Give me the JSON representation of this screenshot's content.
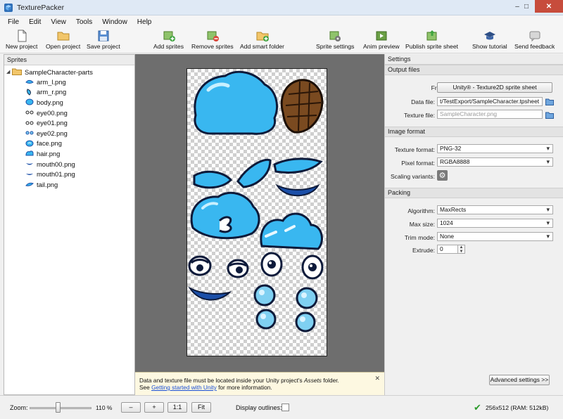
{
  "window": {
    "title": "TexturePacker",
    "controls": {
      "minimize": "–",
      "maximize": "□",
      "close": "✕"
    }
  },
  "menu": [
    "File",
    "Edit",
    "View",
    "Tools",
    "Window",
    "Help"
  ],
  "toolbar": [
    {
      "label": "New project",
      "icon": "new-file-icon"
    },
    {
      "label": "Open project",
      "icon": "open-folder-icon"
    },
    {
      "label": "Save project",
      "icon": "save-disk-icon"
    },
    {
      "label": "Add sprites",
      "icon": "add-sprites-icon"
    },
    {
      "label": "Remove sprites",
      "icon": "remove-sprites-icon"
    },
    {
      "label": "Add smart folder",
      "icon": "add-smart-folder-icon"
    },
    {
      "label": "Sprite settings",
      "icon": "sprite-settings-icon"
    },
    {
      "label": "Anim preview",
      "icon": "anim-preview-icon"
    },
    {
      "label": "Publish sprite sheet",
      "icon": "publish-icon"
    },
    {
      "label": "Show tutorial",
      "icon": "graduation-cap-icon"
    },
    {
      "label": "Send feedback",
      "icon": "feedback-icon"
    }
  ],
  "sprites_panel": {
    "header": "Sprites",
    "root": {
      "label": "SampleCharacter-parts",
      "icon": "folder-icon",
      "expanded": true
    },
    "items": [
      {
        "label": "arm_l.png",
        "thumb": "arm-thumb-icon"
      },
      {
        "label": "arm_r.png",
        "thumb": "arm-thumb-icon"
      },
      {
        "label": "body.png",
        "thumb": "body-thumb-icon"
      },
      {
        "label": "eye00.png",
        "thumb": "eye-thumb-icon"
      },
      {
        "label": "eye01.png",
        "thumb": "eye-thumb-icon"
      },
      {
        "label": "eye02.png",
        "thumb": "eye-thumb-icon"
      },
      {
        "label": "face.png",
        "thumb": "face-thumb-icon"
      },
      {
        "label": "hair.png",
        "thumb": "hair-thumb-icon"
      },
      {
        "label": "mouth00.png",
        "thumb": "mouth-thumb-icon"
      },
      {
        "label": "mouth01.png",
        "thumb": "mouth-thumb-icon"
      },
      {
        "label": "tail.png",
        "thumb": "tail-thumb-icon"
      }
    ]
  },
  "info": {
    "line1_prefix": "Data and texture file must be located inside your Unity project's ",
    "line1_italic": "Assets",
    "line1_suffix": " folder.",
    "line2_prefix": "See ",
    "line2_link": "Getting started with Unity",
    "line2_suffix": " for more information.",
    "close": "✕"
  },
  "settings": {
    "header": "Settings",
    "output": {
      "header": "Output files",
      "framework_label": "Framework:",
      "framework_value": "Unity® - Texture2D sprite sheet",
      "data_file_label": "Data file:",
      "data_file_value": "t/TestExport/SampleCharacter.tpsheet",
      "texture_file_label": "Texture file:",
      "texture_file_value": "SampleCharacter.png"
    },
    "image": {
      "header": "Image format",
      "texture_format_label": "Texture format:",
      "texture_format_value": "PNG-32",
      "pixel_format_label": "Pixel format:",
      "pixel_format_value": "RGBA8888",
      "scaling_label": "Scaling variants:"
    },
    "packing": {
      "header": "Packing",
      "algorithm_label": "Algorithm:",
      "algorithm_value": "MaxRects",
      "max_size_label": "Max size:",
      "max_size_value": "1024",
      "trim_label": "Trim mode:",
      "trim_value": "None",
      "extrude_label": "Extrude:",
      "extrude_value": "0"
    },
    "advanced_button": "Advanced settings >>"
  },
  "statusbar": {
    "zoom_label": "Zoom:",
    "zoom_value": "110 %",
    "zoom_level": 0.45,
    "minus": "–",
    "plus": "+",
    "one_to_one": "1:1",
    "fit": "Fit",
    "display_outlines_label": "Display outlines:",
    "display_outlines_checked": false,
    "status": "256x512 (RAM: 512kB)"
  },
  "colors": {
    "sprite_blue": "#39b7f0",
    "sprite_dark": "#1b4fa8",
    "canvas_bg": "#6e6e6e",
    "info_bg": "#fdf8e1"
  }
}
